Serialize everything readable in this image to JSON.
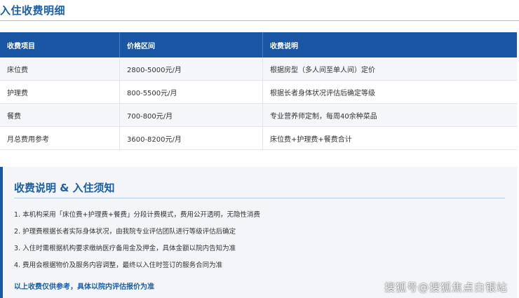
{
  "section_title": "入住收费明细",
  "table": {
    "headers": [
      "收费项目",
      "价格区间",
      "收费说明"
    ],
    "rows": [
      [
        "床位费",
        "2800-5000元/月",
        "根据房型（多人间至单人间）定价"
      ],
      [
        "护理费",
        "800-5500元/月",
        "根据长者身体状况评估后确定等级"
      ],
      [
        "餐费",
        "700-800元/月",
        "专业营养师定制，每周40余种菜品"
      ],
      [
        "月总费用参考",
        "3600-8200元/月",
        "床位费+护理费+餐费合计"
      ]
    ]
  },
  "notes": {
    "title": "收费说明 & 入住须知",
    "items": [
      "1. 本机构采用「床位费+护理费+餐费」分段计费模式，费用公开透明，无隐性消费",
      "2. 护理费根据长者实际身体状况，由我院专业评估团队进行等级评估后确定",
      "3. 入住时需根据机构要求缴纳医疗备用金及押金，具体金额以院内告知为准",
      "4. 费用会根据物价及服务内容调整，最终以入住时签订的服务合同为准"
    ],
    "footer": "以上收费仅供参考，具体以院内评估报价为准"
  },
  "watermark": "搜狐号@搜狐焦点白银站",
  "colors": {
    "accent": "#1a5fa8",
    "header_bg": "#1a56a4",
    "panel_bg": "#f3f5f8"
  }
}
